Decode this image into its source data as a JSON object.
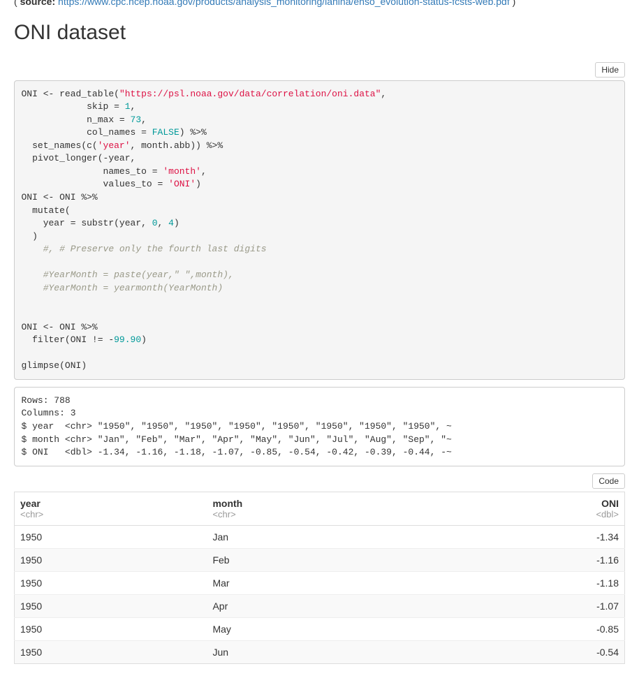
{
  "source": {
    "prefix": "( ",
    "label": "source:",
    "url_text": "https://www.cpc.ncep.noaa.gov/products/analysis_monitoring/lanina/enso_evolution-status-fcsts-web.pdf",
    "suffix": " )"
  },
  "section_title": "ONI dataset",
  "hide_button": "Hide",
  "code_button": "Code",
  "code": {
    "p1": "ONI <- read_table(",
    "p2_str": "\"https://psl.noaa.gov/data/correlation/oni.data\"",
    "p3": ",",
    "p4": "            skip = ",
    "p4n": "1",
    "p5": ",",
    "p6": "            n_max = ",
    "p6n": "73",
    "p7": ",",
    "p8": "            col_names = ",
    "p8k": "FALSE",
    "p9": ") %>%",
    "p10": "  set_names(c(",
    "p10s": "'year'",
    "p11": ", month.abb)) %>%",
    "p12": "  pivot_longer(-year,",
    "p13": "               names_to = ",
    "p13s": "'month'",
    "p14": ",",
    "p15": "               values_to = ",
    "p15s": "'ONI'",
    "p16": ")",
    "p17": "ONI <- ONI %>%",
    "p18": "  mutate(",
    "p19": "    year = substr(year, ",
    "p19n1": "0",
    "p19m": ", ",
    "p19n2": "4",
    "p20": ")",
    "p21": "  )",
    "c1": "    #, # Preserve only the fourth last digits",
    "c2": "    #YearMonth = paste(year,\" \",month),",
    "c3": "    #YearMonth = yearmonth(YearMonth)",
    "p22": "ONI <- ONI %>%",
    "p23": "  filter(ONI != -",
    "p23n": "99.90",
    "p24": ")",
    "p25": "glimpse(ONI)"
  },
  "output": "Rows: 788\nColumns: 3\n$ year  <chr> \"1950\", \"1950\", \"1950\", \"1950\", \"1950\", \"1950\", \"1950\", \"1950\", ~\n$ month <chr> \"Jan\", \"Feb\", \"Mar\", \"Apr\", \"May\", \"Jun\", \"Jul\", \"Aug\", \"Sep\", \"~\n$ ONI   <dbl> -1.34, -1.16, -1.18, -1.07, -0.85, -0.54, -0.42, -0.39, -0.44, -~",
  "table": {
    "headers": {
      "year": "year",
      "month": "month",
      "oni": "ONI"
    },
    "types": {
      "year": "<chr>",
      "month": "<chr>",
      "oni": "<dbl>"
    },
    "rows": [
      {
        "year": "1950",
        "month": "Jan",
        "oni": "-1.34"
      },
      {
        "year": "1950",
        "month": "Feb",
        "oni": "-1.16"
      },
      {
        "year": "1950",
        "month": "Mar",
        "oni": "-1.18"
      },
      {
        "year": "1950",
        "month": "Apr",
        "oni": "-1.07"
      },
      {
        "year": "1950",
        "month": "May",
        "oni": "-0.85"
      },
      {
        "year": "1950",
        "month": "Jun",
        "oni": "-0.54"
      }
    ]
  }
}
